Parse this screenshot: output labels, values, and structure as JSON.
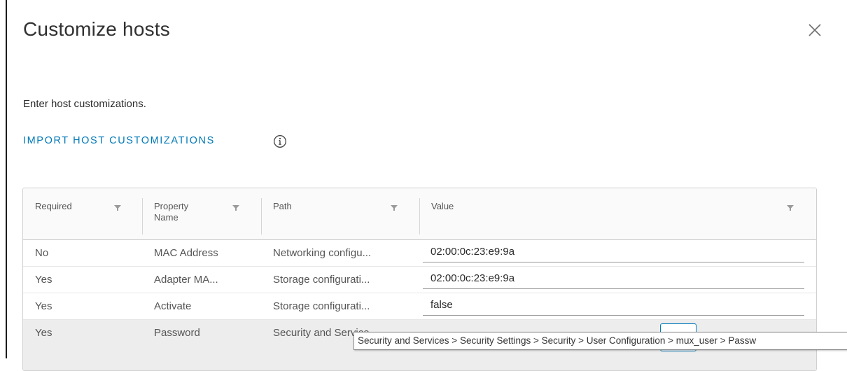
{
  "dialog": {
    "title": "Customize hosts",
    "close_icon": "close-icon",
    "subtitle": "Enter host customizations.",
    "import_link": "IMPORT HOST CUSTOMIZATIONS",
    "info_icon": "info-icon"
  },
  "grid": {
    "columns": [
      {
        "label": "Required"
      },
      {
        "label": "Property\nName"
      },
      {
        "label": "Path"
      },
      {
        "label": "Value"
      }
    ],
    "rows": [
      {
        "required": "No",
        "property": "MAC Address",
        "path": "Networking configu...",
        "value": "02:00:0c:23:e9:9a"
      },
      {
        "required": "Yes",
        "property": "Adapter MA...",
        "path": "Storage configurati...",
        "value": "02:00:0c:23:e9:9a"
      },
      {
        "required": "Yes",
        "property": "Activate",
        "path": "Storage configurati...",
        "value": "false"
      },
      {
        "required": "Yes",
        "property": "Password",
        "path": "Security and Service",
        "value": ""
      }
    ],
    "row_action_label": "..."
  },
  "tooltip": {
    "text": "Security and Services > Security Settings > Security > User Configuration > mux_user > Passw"
  },
  "colors": {
    "link": "#0079b8",
    "selected_row": "#ededed",
    "header_bg": "#fafafa"
  }
}
